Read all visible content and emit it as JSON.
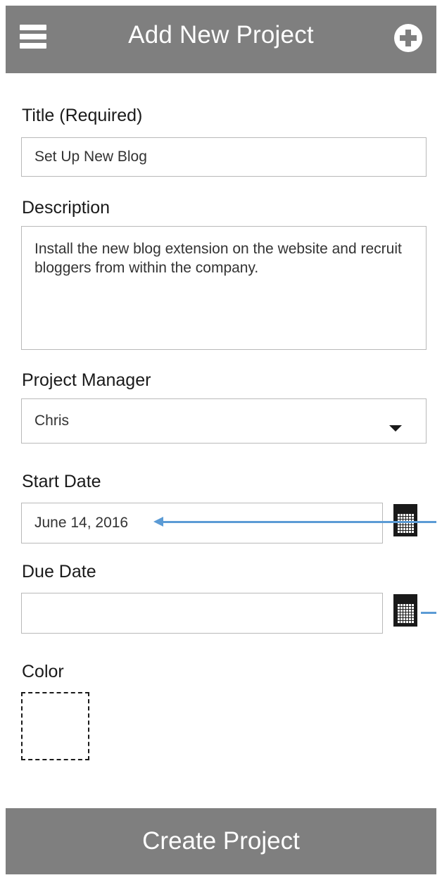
{
  "header": {
    "title": "Add New Project",
    "menu_icon": "hamburger-menu-icon",
    "add_icon": "plus-circle-icon"
  },
  "form": {
    "title": {
      "label": "Title (Required)",
      "value": "Set Up New Blog"
    },
    "description": {
      "label": "Description",
      "value": "Install the new blog extension on the website and recruit bloggers from within the company."
    },
    "project_manager": {
      "label": "Project Manager",
      "value": "Chris"
    },
    "start_date": {
      "label": "Start Date",
      "value": "June 14, 2016"
    },
    "due_date": {
      "label": "Due Date",
      "value": ""
    },
    "color": {
      "label": "Color"
    }
  },
  "footer": {
    "create_label": "Create Project"
  },
  "colors": {
    "header_bg": "#7f7f7f",
    "annotation_arrow": "#5b9bd5",
    "field_border": "#b9b9b9"
  }
}
